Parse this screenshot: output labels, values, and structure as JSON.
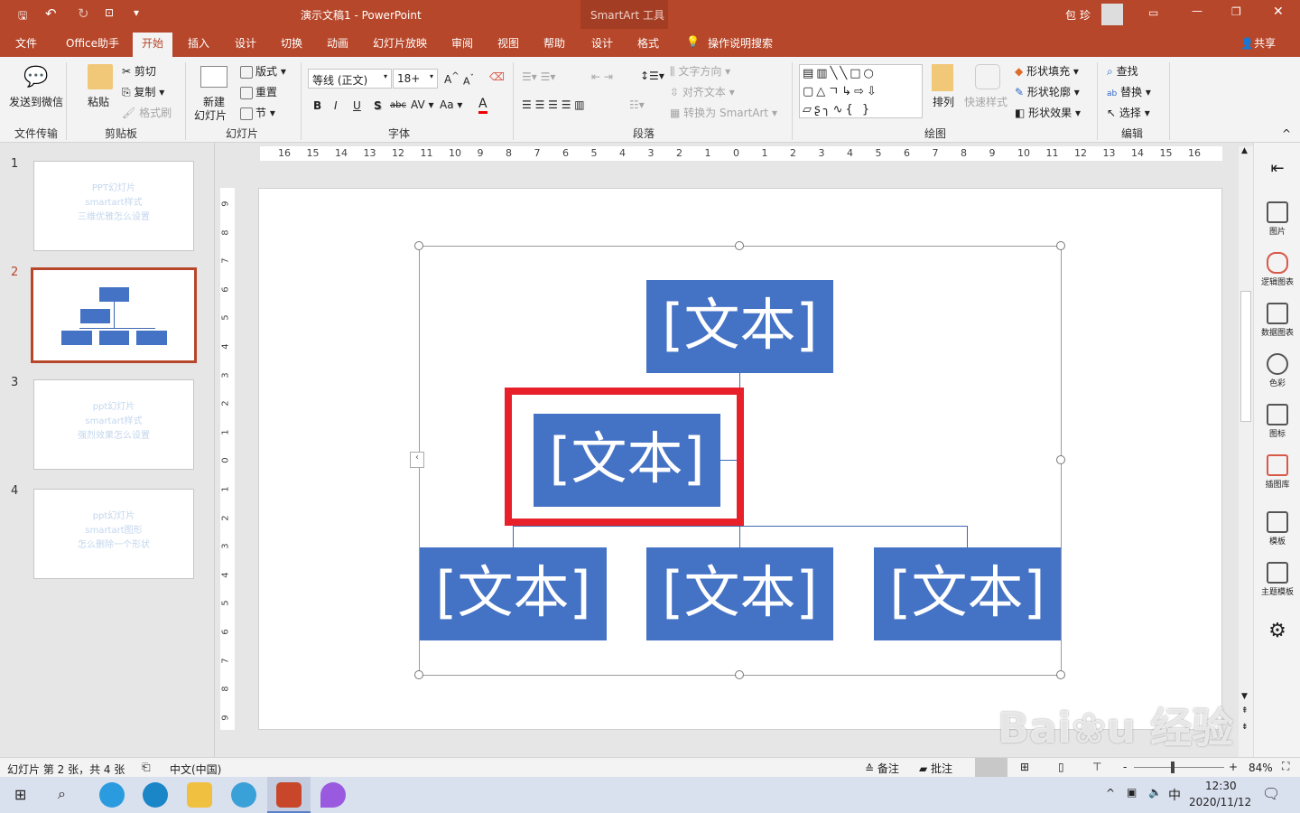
{
  "titlebar": {
    "doc_title": "演示文稿1  -  PowerPoint",
    "context_tool": "SmartArt 工具",
    "user": "包 珍"
  },
  "tabs": [
    {
      "label": "文件"
    },
    {
      "label": "Office助手"
    },
    {
      "label": "开始",
      "active": true
    },
    {
      "label": "插入"
    },
    {
      "label": "设计"
    },
    {
      "label": "切换"
    },
    {
      "label": "动画"
    },
    {
      "label": "幻灯片放映"
    },
    {
      "label": "审阅"
    },
    {
      "label": "视图"
    },
    {
      "label": "帮助"
    },
    {
      "label": "设计"
    },
    {
      "label": "格式"
    }
  ],
  "tell_me": "操作说明搜索",
  "share": "共享",
  "ribbon": {
    "groups": {
      "file_transfer": "文件传输",
      "clipboard": "剪贴板",
      "slides": "幻灯片",
      "font": "字体",
      "paragraph": "段落",
      "drawing": "绘图",
      "editing": "编辑"
    },
    "send_wechat": "发送到微信",
    "paste": "粘贴",
    "cut": "剪切",
    "copy": "复制",
    "format_painter": "格式刷",
    "new_slide_1": "新建",
    "new_slide_2": "幻灯片",
    "layout": "版式",
    "reset": "重置",
    "section": "节",
    "font_name": "等线 (正文)",
    "font_size": "18+",
    "bold": "B",
    "italic": "I",
    "underline": "U",
    "shadow": "S",
    "strike": "abc",
    "spacing": "AV",
    "case": "Aa",
    "font_color": "A",
    "text_direction": "文字方向",
    "align_text": "对齐文本",
    "convert_smartart": "转换为 SmartArt",
    "arrange": "排列",
    "quick_styles": "快速样式",
    "shape_fill": "形状填充",
    "shape_outline": "形状轮廓",
    "shape_effects": "形状效果",
    "find": "查找",
    "replace": "替换",
    "select": "选择"
  },
  "slides": [
    {
      "number": "1",
      "lines": [
        "PPT幻灯片",
        "smartart样式",
        "三维优雅怎么设置"
      ]
    },
    {
      "number": "2",
      "active": true
    },
    {
      "number": "3",
      "lines": [
        "ppt幻灯片",
        "smartart样式",
        "强烈效果怎么设置"
      ]
    },
    {
      "number": "4",
      "lines": [
        "ppt幻灯片",
        "smartart图形",
        "怎么删除一个形状"
      ]
    }
  ],
  "hruler": [
    "16",
    "15",
    "14",
    "13",
    "12",
    "11",
    "10",
    "9",
    "8",
    "7",
    "6",
    "5",
    "4",
    "3",
    "2",
    "1",
    "0",
    "1",
    "2",
    "3",
    "4",
    "5",
    "6",
    "7",
    "8",
    "9",
    "10",
    "11",
    "12",
    "13",
    "14",
    "15",
    "16"
  ],
  "vruler": [
    "9",
    "8",
    "7",
    "6",
    "5",
    "4",
    "3",
    "2",
    "1",
    "0",
    "1",
    "2",
    "3",
    "4",
    "5",
    "6",
    "7",
    "8",
    "9"
  ],
  "smartart": {
    "top": "[文本]",
    "mid": "[文本]",
    "b1": "[文本]",
    "b2": "[文本]",
    "b3": "[文本]",
    "fill": "#4472c4",
    "highlight": "#e8202a"
  },
  "right_panel": [
    "图片",
    "逻辑图表",
    "数据图表",
    "色彩",
    "图标",
    "插图库",
    "模板",
    "主题模板"
  ],
  "status": {
    "slide_info": "幻灯片 第 2 张，共 4 张",
    "language": "中文(中国)",
    "notes": "备注",
    "comments": "批注",
    "zoom": "84%"
  },
  "taskbar": {
    "time": "12:30",
    "date": "2020/11/12",
    "ime": "中"
  },
  "watermark": "Baidu 经验 jingyan.baidu.com",
  "colors": {
    "accent": "#b7472a"
  }
}
